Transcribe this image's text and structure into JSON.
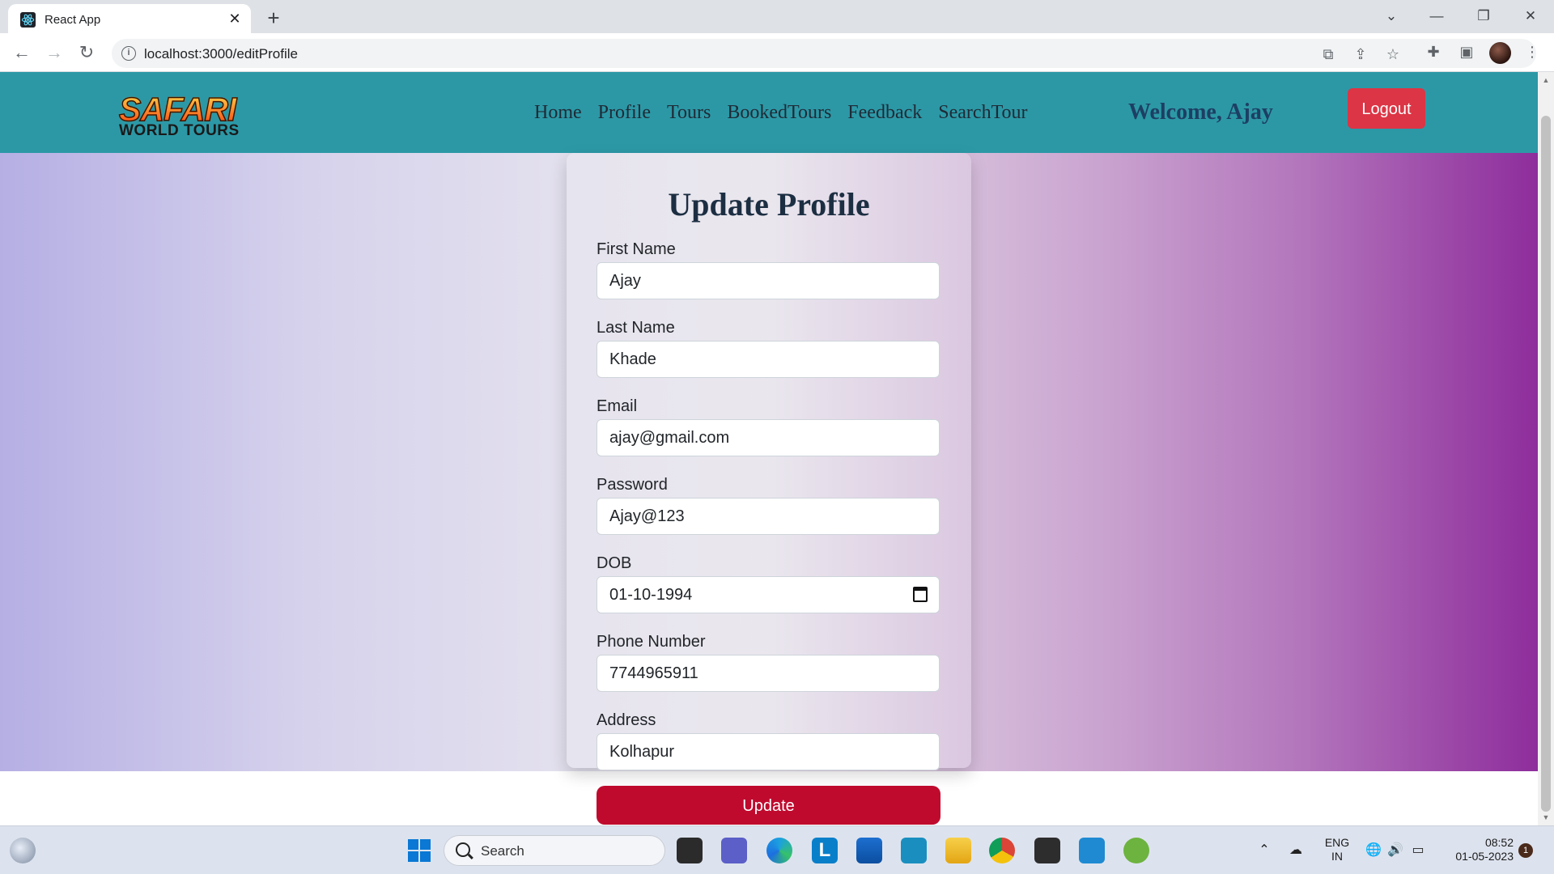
{
  "browser": {
    "tab_title": "React App",
    "tab_close": "✕",
    "new_tab": "+",
    "url": "localhost:3000/editProfile",
    "window_controls": {
      "dropdown": "⌄",
      "minimize": "—",
      "restore": "❐",
      "close": "✕"
    }
  },
  "navbar": {
    "logo_top": "SAFARI",
    "logo_bottom": "WORLD TOURS",
    "links": [
      "Home",
      "Profile",
      "Tours",
      "BookedTours",
      "Feedback",
      "SearchTour"
    ],
    "welcome": "Welcome, Ajay",
    "logout_label": "Logout",
    "bg_color": "#2c98a6",
    "logout_color": "#dc3545"
  },
  "form": {
    "title": "Update Profile",
    "fields": [
      {
        "label": "First Name",
        "value": "Ajay"
      },
      {
        "label": "Last Name",
        "value": "Khade"
      },
      {
        "label": "Email",
        "value": "ajay@gmail.com"
      },
      {
        "label": "Password",
        "value": "Ajay@123"
      },
      {
        "label": "DOB",
        "value": "01-10-1994"
      },
      {
        "label": "Phone Number",
        "value": "7744965911"
      },
      {
        "label": "Address",
        "value": "Kolhapur"
      }
    ],
    "update_label": "Update",
    "update_color": "#bf0a2e"
  },
  "taskbar": {
    "search_label": "Search",
    "language": "ENG",
    "region": "IN",
    "time": "08:52",
    "date": "01-05-2023",
    "notification_count": "1"
  }
}
